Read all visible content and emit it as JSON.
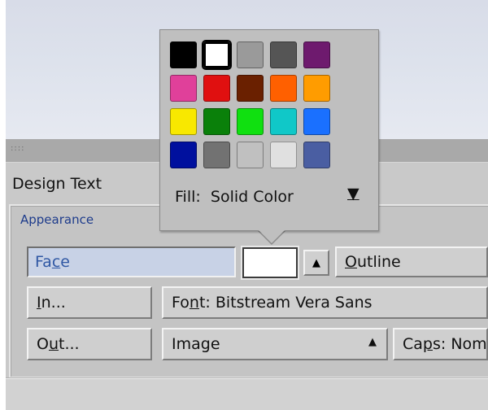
{
  "panel": {
    "grip": "::::",
    "title": "Design Text",
    "group_label": "Appearance"
  },
  "face_field": {
    "value": "Face"
  },
  "appearance": {
    "arrow_up": "▲",
    "outline_label": "Outline",
    "in_button": "In...",
    "out_button": "Out...",
    "font_label": "Font:",
    "font_value": "Bitstream Vera Sans",
    "image_label": "Image",
    "caps_label": "Caps:",
    "caps_value": "Nom"
  },
  "popup": {
    "fill_label": "Fill:",
    "fill_value": "Solid Color",
    "menu_arrow": "▼",
    "swatches": [
      "#000000",
      "#ffffff",
      "#9a9a9a",
      "#555555",
      "#6e1a6e",
      "#e0409a",
      "#e01010",
      "#6a2000",
      "#ff6000",
      "#ff9c00",
      "#f8e800",
      "#0a800a",
      "#10e010",
      "#10c8c8",
      "#1a70ff",
      "#00109e",
      "#727272",
      "#c0c0c0",
      "#e0e0e0",
      "#4a5ea2"
    ],
    "selected_index": 1
  }
}
